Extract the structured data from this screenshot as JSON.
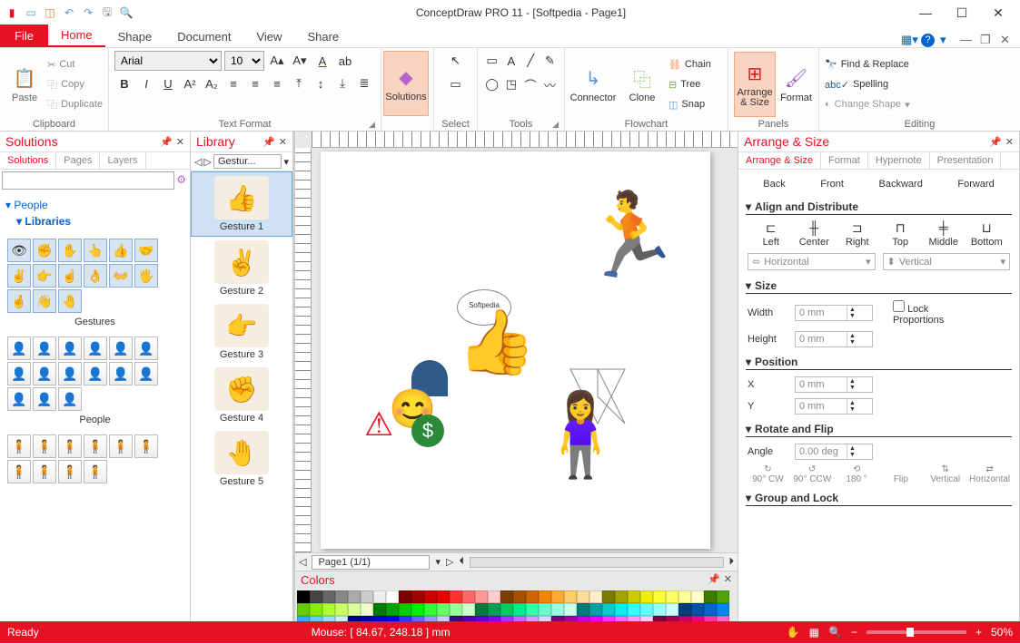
{
  "title": "ConceptDraw PRO 11 - [Softpedia - Page1]",
  "ribbon": {
    "file": "File",
    "tabs": [
      "Home",
      "Shape",
      "Document",
      "View",
      "Share"
    ],
    "active_tab": "Home",
    "clipboard": {
      "paste": "Paste",
      "cut": "Cut",
      "copy": "Copy",
      "duplicate": "Duplicate",
      "label": "Clipboard"
    },
    "textformat": {
      "font": "Arial",
      "size": "10",
      "label": "Text Format"
    },
    "solutions": "Solutions",
    "select": "Select",
    "tools": "Tools",
    "connector": "Connector",
    "clone": "Clone",
    "flowchart_items": {
      "chain": "Chain",
      "tree": "Tree",
      "snap": "Snap"
    },
    "flowchart": "Flowchart",
    "arrange": "Arrange & Size",
    "format": "Format",
    "panels": "Panels",
    "editing_items": {
      "find": "Find & Replace",
      "spelling": "Spelling",
      "change": "Change Shape"
    },
    "editing": "Editing"
  },
  "solutions_panel": {
    "title": "Solutions",
    "tabs": [
      "Solutions",
      "Pages",
      "Layers"
    ],
    "tree": {
      "people": "People",
      "libraries": "Libraries"
    },
    "groups": [
      {
        "name": "Gestures"
      },
      {
        "name": "People"
      }
    ]
  },
  "library_panel": {
    "title": "Library",
    "crumb": "Gestur...",
    "items": [
      "Gesture 1",
      "Gesture 2",
      "Gesture 3",
      "Gesture 4",
      "Gesture 5"
    ]
  },
  "canvas": {
    "page_nav": "Page1 (1/1)",
    "bubble_text": "Softpedia"
  },
  "colors": {
    "title": "Colors",
    "swatches": [
      "#000",
      "#444",
      "#666",
      "#888",
      "#aaa",
      "#ccc",
      "#eee",
      "#fff",
      "#7b0000",
      "#a30000",
      "#c00",
      "#e00",
      "#f33",
      "#f66",
      "#f99",
      "#fcc",
      "#7b3f00",
      "#a35200",
      "#c60",
      "#e80",
      "#fa3",
      "#fc6",
      "#fd9",
      "#fec",
      "#7b7b00",
      "#a3a300",
      "#cc0",
      "#ee0",
      "#ff3",
      "#ff6",
      "#ff9",
      "#ffc",
      "#3f7b00",
      "#52a300",
      "#6c0",
      "#8e0",
      "#af3",
      "#cf6",
      "#df9",
      "#efc",
      "#007b00",
      "#00a300",
      "#0c0",
      "#0e0",
      "#3f3",
      "#6f6",
      "#9f9",
      "#cfc",
      "#007b3f",
      "#00a352",
      "#0c6",
      "#0e8",
      "#3fa",
      "#6fc",
      "#9fd",
      "#cfe",
      "#007b7b",
      "#00a3a3",
      "#0cc",
      "#0ee",
      "#3ff",
      "#6ff",
      "#9ff",
      "#cff",
      "#003f7b",
      "#0052a3",
      "#06c",
      "#08e",
      "#3af",
      "#6cf",
      "#9df",
      "#cef",
      "#00007b",
      "#0000a3",
      "#00c",
      "#00e",
      "#33f",
      "#66f",
      "#99f",
      "#ccf",
      "#3f007b",
      "#5200a3",
      "#60c",
      "#80e",
      "#a3f",
      "#c6f",
      "#d9f",
      "#ecf",
      "#7b007b",
      "#a300a3",
      "#c0c",
      "#e0e",
      "#f3f",
      "#f6f",
      "#f9f",
      "#fcf",
      "#7b003f",
      "#a30052",
      "#c06",
      "#e08",
      "#f3a",
      "#f6c",
      "#f9d",
      "#fce"
    ]
  },
  "arrange_panel": {
    "title": "Arrange & Size",
    "tabs": [
      "Arrange & Size",
      "Format",
      "Hypernote",
      "Presentation"
    ],
    "order": [
      "Back",
      "Front",
      "Backward",
      "Forward"
    ],
    "sect_align": "Align and Distribute",
    "align": [
      "Left",
      "Center",
      "Right",
      "Top",
      "Middle",
      "Bottom"
    ],
    "dist_h": "Horizontal",
    "dist_v": "Vertical",
    "sect_size": "Size",
    "width": "Width",
    "height": "Height",
    "zero_mm": "0 mm",
    "lock": "Lock Proportions",
    "sect_pos": "Position",
    "x": "X",
    "y": "Y",
    "sect_rot": "Rotate and Flip",
    "angle": "Angle",
    "zero_deg": "0.00 deg",
    "rot_labels": [
      "90° CW",
      "90° CCW",
      "180 °",
      "Flip",
      "Vertical",
      "Horizontal"
    ],
    "sect_group": "Group and Lock"
  },
  "status": {
    "ready": "Ready",
    "mouse": "Mouse: [ 84.67, 248.18 ] mm",
    "zoom": "50%"
  }
}
